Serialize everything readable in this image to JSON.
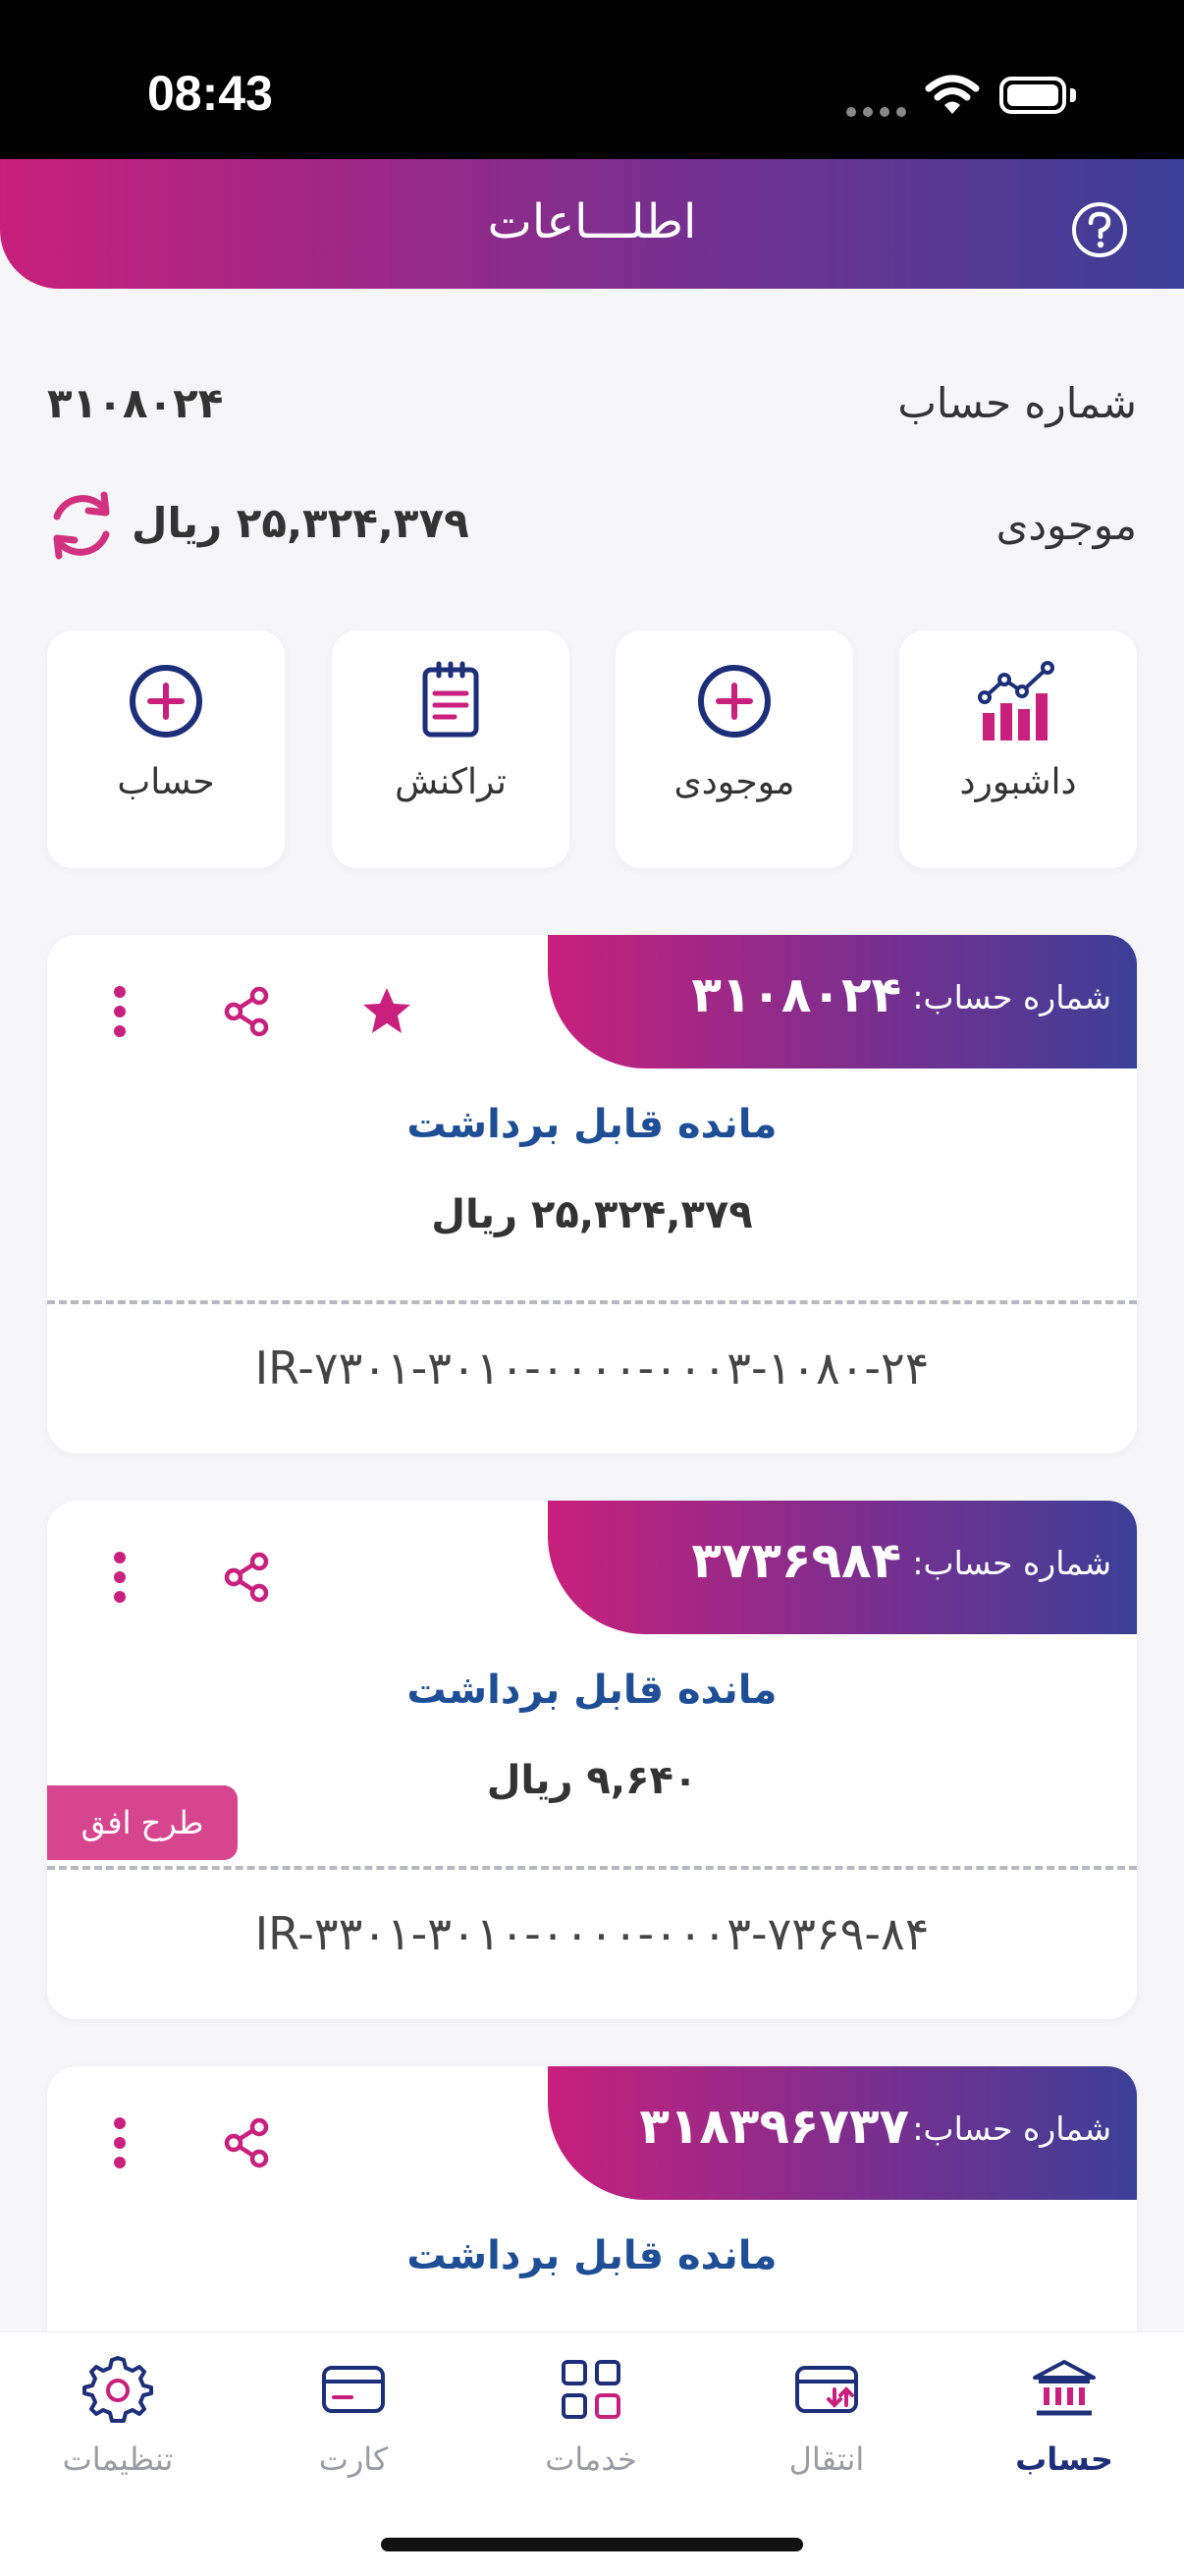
{
  "status_bar": {
    "time": "08:43"
  },
  "header": {
    "title": "اطلـــاعات",
    "help_icon": "help-circle-icon"
  },
  "summary": {
    "account_label": "شماره حساب",
    "account_value": "۳۱۰۸۰۲۴",
    "balance_label": "موجودی",
    "balance_value": "۲۵,۳۲۴,۳۷۹ ریال"
  },
  "quick_actions": [
    {
      "label": "داشبورد",
      "icon": "dashboard-chart-icon"
    },
    {
      "label": "موجودی",
      "icon": "add-circle-icon"
    },
    {
      "label": "تراکنش",
      "icon": "transaction-list-icon"
    },
    {
      "label": "حساب",
      "icon": "add-circle-icon"
    }
  ],
  "cards": [
    {
      "account_label": "شماره حساب:",
      "account_number": "۳۱۰۸۰۲۴",
      "balance_title": "مانده قابل برداشت",
      "balance": "۲۵,۳۲۴,۳۷۹ ریال",
      "iban": "IR-۷۳۰۱-۳۰۱۰-۰۰۰۰-۰۰۰۳-۱۰۸۰-۲۴",
      "favorite": true
    },
    {
      "account_label": "شماره حساب:",
      "account_number": "۳۷۳۶۹۸۴",
      "balance_title": "مانده قابل برداشت",
      "balance": "۹,۶۴۰ ریال",
      "iban": "IR-۳۳۰۱-۳۰۱۰-۰۰۰۰-۰۰۰۳-۷۳۶۹-۸۴",
      "badge": "طرح افق",
      "favorite": false
    },
    {
      "account_label": "شماره حساب:",
      "account_number": "۳۱۸۳۹۶۷۳۷",
      "balance_title": "مانده قابل برداشت",
      "favorite": false
    }
  ],
  "bottom_nav": [
    {
      "label": "تنظیمات",
      "icon": "settings-gear-icon"
    },
    {
      "label": "کارت",
      "icon": "card-icon"
    },
    {
      "label": "خدمات",
      "icon": "services-grid-icon"
    },
    {
      "label": "انتقال",
      "icon": "transfer-icon"
    },
    {
      "label": "حساب",
      "icon": "bank-icon",
      "active": true
    }
  ],
  "colors": {
    "accent_pink": "#c8207c",
    "accent_blue": "#3b3f97",
    "title_blue": "#1e4f96",
    "nav_active": "#1e2f7a"
  }
}
